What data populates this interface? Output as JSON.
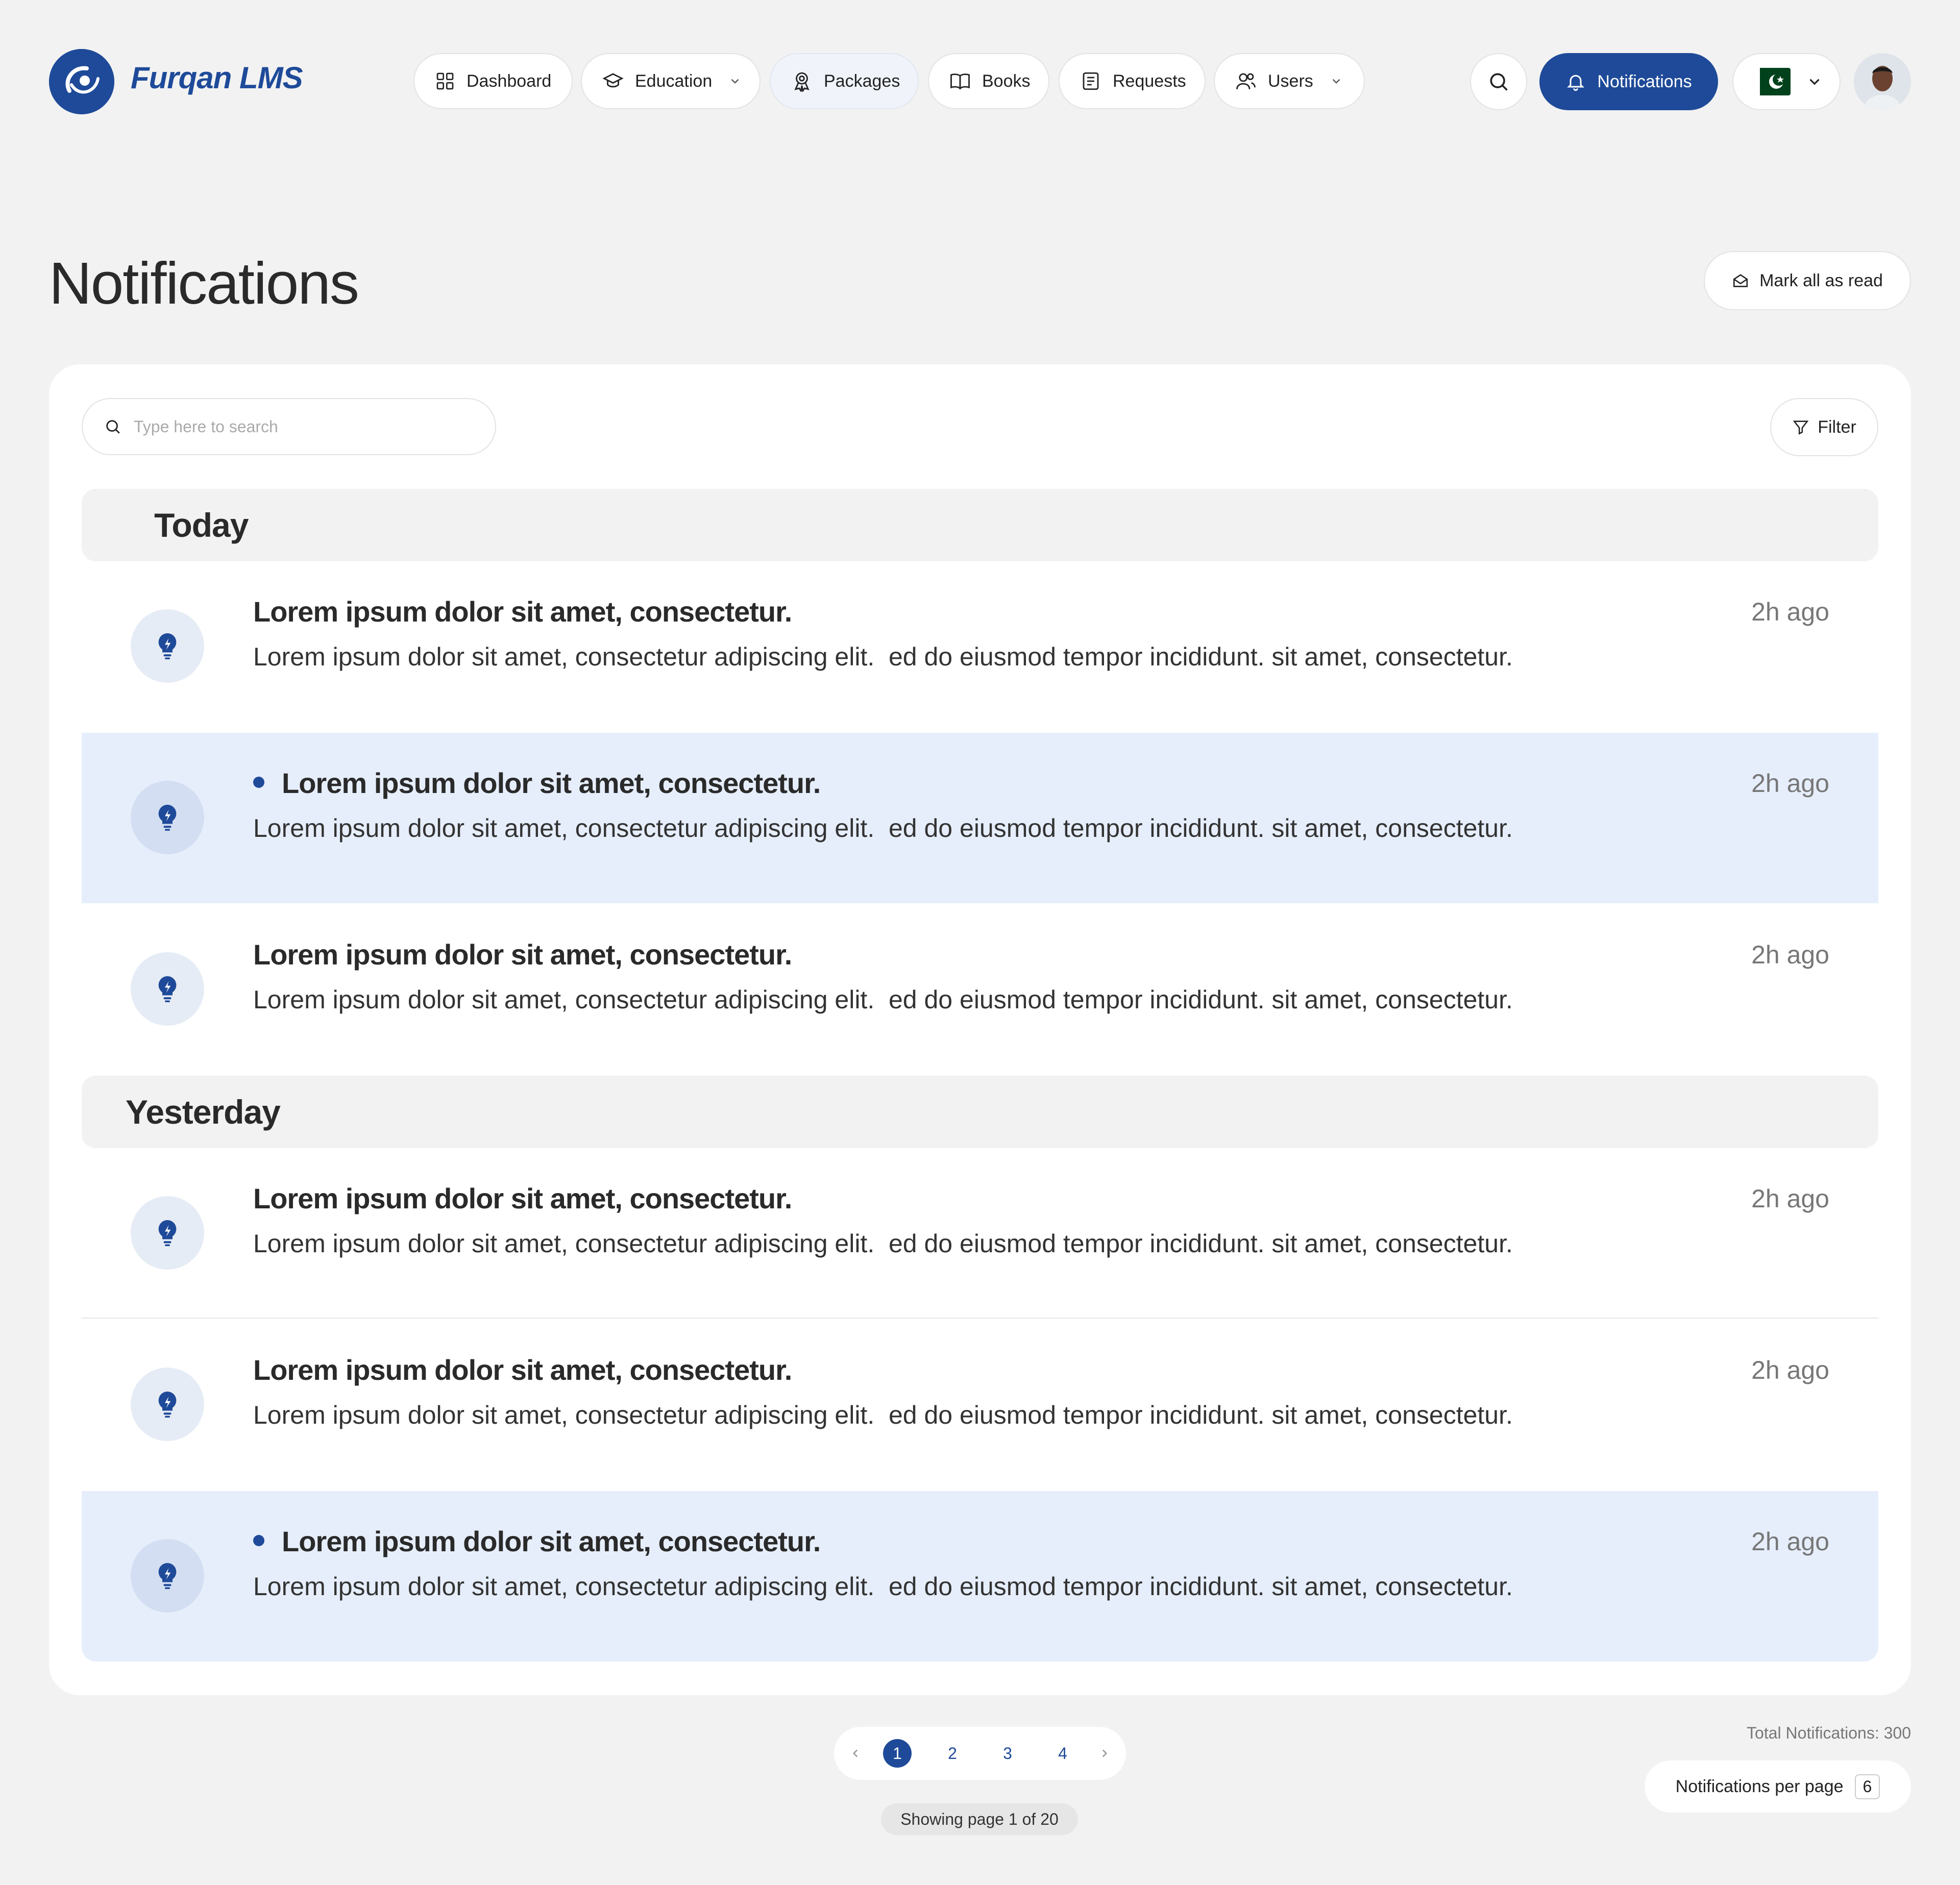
{
  "app": {
    "name": "Furqan LMS"
  },
  "nav": {
    "items": [
      {
        "label": "Dashboard",
        "icon": "grid-icon"
      },
      {
        "label": "Education",
        "icon": "graduation-cap-icon",
        "dropdown": true
      },
      {
        "label": "Packages",
        "icon": "award-icon",
        "active": true
      },
      {
        "label": "Books",
        "icon": "book-open-icon"
      },
      {
        "label": "Requests",
        "icon": "document-icon"
      },
      {
        "label": "Users",
        "icon": "users-icon",
        "dropdown": true
      }
    ],
    "notifications_label": "Notifications",
    "language_flag": "pakistan-flag"
  },
  "page": {
    "title": "Notifications",
    "mark_all_label": "Mark all as read",
    "search_placeholder": "Type here to search",
    "filter_label": "Filter"
  },
  "groups": [
    {
      "label": "Today",
      "items": [
        {
          "title": "Lorem ipsum dolor sit amet, consectetur.",
          "body": "Lorem ipsum dolor sit amet, consectetur adipiscing elit.  ed do eiusmod tempor incididunt. sit amet, consectetur.",
          "time": "2h ago",
          "unread": false
        },
        {
          "title": "Lorem ipsum dolor sit amet, consectetur.",
          "body": "Lorem ipsum dolor sit amet, consectetur adipiscing elit.  ed do eiusmod tempor incididunt. sit amet, consectetur.",
          "time": "2h ago",
          "unread": true
        },
        {
          "title": "Lorem ipsum dolor sit amet, consectetur.",
          "body": "Lorem ipsum dolor sit amet, consectetur adipiscing elit.  ed do eiusmod tempor incididunt. sit amet, consectetur.",
          "time": "2h ago",
          "unread": false
        }
      ]
    },
    {
      "label": "Yesterday",
      "items": [
        {
          "title": "Lorem ipsum dolor sit amet, consectetur.",
          "body": "Lorem ipsum dolor sit amet, consectetur adipiscing elit.  ed do eiusmod tempor incididunt. sit amet, consectetur.",
          "time": "2h ago",
          "unread": false
        },
        {
          "title": "Lorem ipsum dolor sit amet, consectetur.",
          "body": "Lorem ipsum dolor sit amet, consectetur adipiscing elit.  ed do eiusmod tempor incididunt. sit amet, consectetur.",
          "time": "2h ago",
          "unread": false
        },
        {
          "title": "Lorem ipsum dolor sit amet, consectetur.",
          "body": "Lorem ipsum dolor sit amet, consectetur adipiscing elit.  ed do eiusmod tempor incididunt. sit amet, consectetur.",
          "time": "2h ago",
          "unread": true
        }
      ]
    }
  ],
  "pagination": {
    "pages": [
      "1",
      "2",
      "3",
      "4"
    ],
    "current": "1",
    "showing_text": "Showing page 1 of 20",
    "total_text": "Total Notifications: 300",
    "per_page_label": "Notifications per page",
    "per_page_value": "6"
  },
  "colors": {
    "brand": "#1e4a99",
    "unread_row": "#e6eefc",
    "background": "#f2f2f2"
  }
}
